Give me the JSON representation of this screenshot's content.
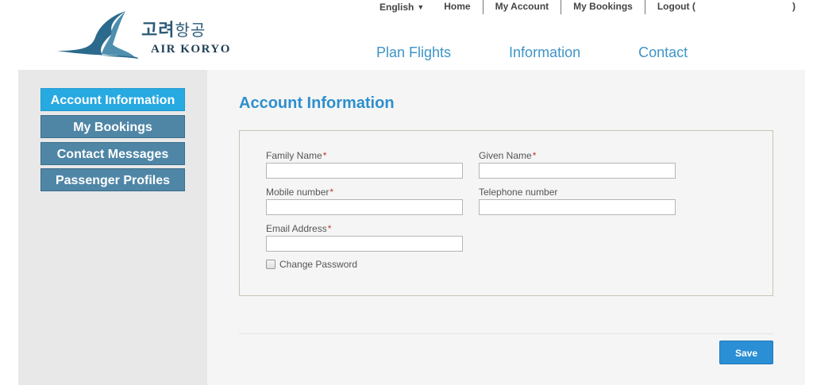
{
  "header": {
    "logo_korean_bold": "고려",
    "logo_korean_thin": "항공",
    "logo_english": "AIR KORYO",
    "language": "English",
    "top_links": {
      "home": "Home",
      "my_account": "My Account",
      "my_bookings": "My Bookings",
      "logout": "Logout (",
      "logout_close": ")"
    },
    "main_nav": {
      "plan_flights": "Plan Flights",
      "information": "Information",
      "contact": "Contact"
    }
  },
  "sidebar": {
    "items": [
      {
        "label": "Account Information",
        "active": true
      },
      {
        "label": "My Bookings",
        "active": false
      },
      {
        "label": "Contact Messages",
        "active": false
      },
      {
        "label": "Passenger Profiles",
        "active": false
      }
    ]
  },
  "main": {
    "title": "Account Information",
    "form": {
      "family_name": {
        "label": "Family Name",
        "required": "*",
        "value": ""
      },
      "given_name": {
        "label": "Given Name",
        "required": "*",
        "value": ""
      },
      "mobile_number": {
        "label": "Mobile number",
        "required": "*",
        "value": ""
      },
      "telephone_number": {
        "label": "Telephone number",
        "value": ""
      },
      "email_address": {
        "label": "Email Address",
        "required": "*",
        "value": ""
      },
      "change_password": {
        "label": "Change Password",
        "checked": false
      }
    },
    "save_label": "Save"
  },
  "colors": {
    "sidebar_active": "#27a9e1",
    "sidebar_inactive": "#4f86a6",
    "title_blue": "#2e8fcc",
    "nav_blue": "#3d94c8",
    "save_button": "#2b8fd6",
    "required_asterisk": "#c0392b"
  },
  "icons": {
    "logo": "bird-logo-icon",
    "language_caret": "caret-down-icon",
    "checkbox": "checkbox-icon"
  }
}
